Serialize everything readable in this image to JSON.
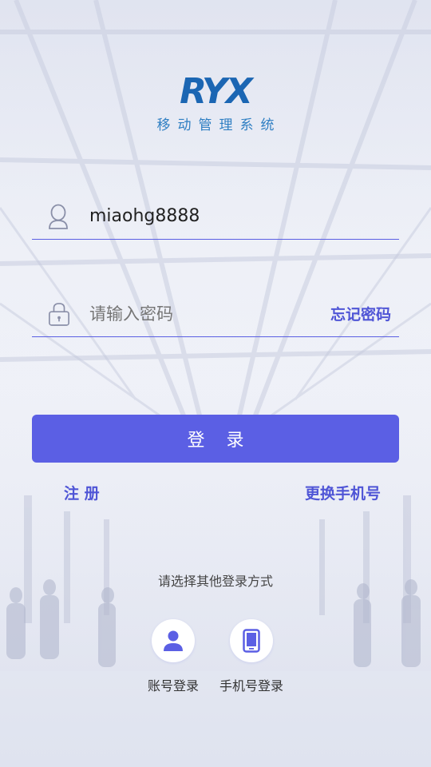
{
  "logo": {
    "mark": "RYX",
    "subtitle": "移动管理系统"
  },
  "login_form": {
    "username_value": "miaohg8888",
    "password_placeholder": "请输入密码",
    "forgot_password": "忘记密码",
    "login_button": "登 录",
    "register_link": "注 册",
    "change_phone_link": "更换手机号"
  },
  "other_login": {
    "title": "请选择其他登录方式",
    "options": [
      {
        "label": "账号登录",
        "icon": "user-icon"
      },
      {
        "label": "手机号登录",
        "icon": "phone-icon"
      }
    ]
  },
  "colors": {
    "accent": "#5b5fe4",
    "link": "#4f55d6",
    "logo": "#1b66b3"
  }
}
